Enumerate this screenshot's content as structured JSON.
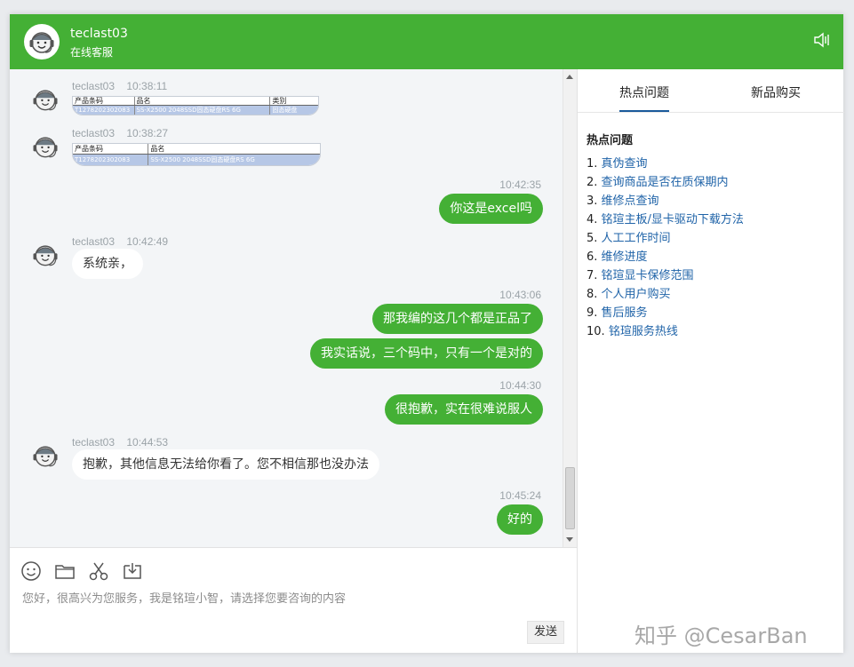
{
  "header": {
    "name": "teclast03",
    "status": "在线客服"
  },
  "messages": [
    {
      "sender": "teclast03",
      "time": "10:38:11",
      "kind": "image-table",
      "columns": [
        "产品条码",
        "品名",
        "类别"
      ],
      "rows": [
        [
          "T1278202302083",
          "SS-X2500 2048SSD固态硬盘RS 6G",
          "固态硬盘"
        ]
      ]
    },
    {
      "sender": "teclast03",
      "time": "10:38:27",
      "kind": "image-table",
      "columns": [
        "产品条码",
        "品名"
      ],
      "rows": [
        [
          "T1278202302083",
          "SS-X2500 2048SSD固态硬盘RS 6G"
        ]
      ]
    },
    {
      "time": "10:42:35",
      "kind": "user",
      "texts": [
        "你这是excel吗"
      ]
    },
    {
      "sender": "teclast03",
      "time": "10:42:49",
      "kind": "agent",
      "text": "系统亲，"
    },
    {
      "time": "10:43:06",
      "kind": "user",
      "texts": [
        "那我编的这几个都是正品了",
        "我实话说，三个码中，只有一个是对的"
      ]
    },
    {
      "time": "10:44:30",
      "kind": "user",
      "texts": [
        "很抱歉，实在很难说服人"
      ]
    },
    {
      "sender": "teclast03",
      "time": "10:44:53",
      "kind": "agent",
      "text": "抱歉，其他信息无法给你看了。您不相信那也没办法"
    },
    {
      "time": "10:45:24",
      "kind": "user",
      "texts": [
        "好的"
      ]
    }
  ],
  "composer": {
    "prompt": "您好，很高兴为您服务，我是铭瑄小智，请选择您要咨询的内容",
    "send_label": "发送",
    "tools": [
      "emoji-icon",
      "folder-icon",
      "scissors-icon",
      "download-icon"
    ]
  },
  "panel": {
    "tabs": [
      "热点问题",
      "新品购买"
    ],
    "active_tab": "热点问题",
    "heading": "热点问题",
    "faq": [
      {
        "num": "1.",
        "label": "真伪查询"
      },
      {
        "num": "2.",
        "label": "查询商品是否在质保期内"
      },
      {
        "num": "3.",
        "label": "维修点查询"
      },
      {
        "num": "4.",
        "label": "铭瑄主板/显卡驱动下载方法"
      },
      {
        "num": "5.",
        "label": "人工工作时间"
      },
      {
        "num": "6.",
        "label": "维修进度"
      },
      {
        "num": "7.",
        "label": "铭瑄显卡保修范围"
      },
      {
        "num": "8.",
        "label": "个人用户购买"
      },
      {
        "num": "9.",
        "label": "售后服务"
      },
      {
        "num": "10.",
        "label": "铭瑄服务热线"
      }
    ]
  },
  "watermark": "知乎 @CesarBan",
  "colors": {
    "brand_green": "#44b035",
    "link_blue": "#1f63a8",
    "chat_bg": "#f3f5f7"
  }
}
